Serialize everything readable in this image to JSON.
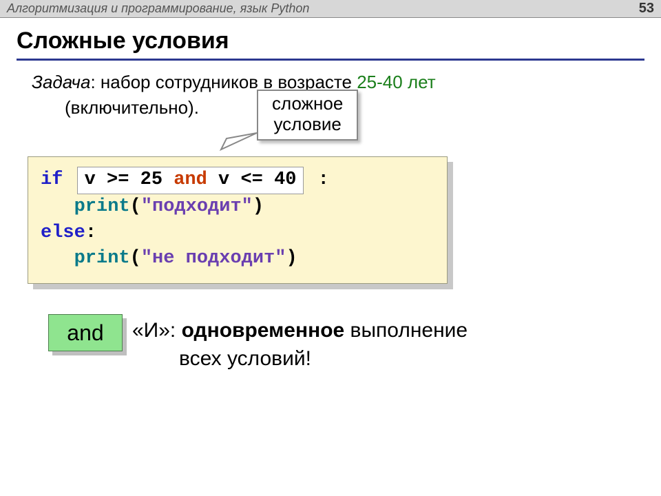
{
  "header": {
    "title": "Алгоритмизация и программирование, язык Python",
    "page": "53"
  },
  "slide": {
    "title": "Сложные условия",
    "task_label": "Задача",
    "task_text": ": набор сотрудников в возрасте ",
    "age_range": "25-40 лет",
    "inclusive": "(включительно).",
    "callout_l1": "сложное",
    "callout_l2": "условие"
  },
  "code": {
    "if_kw": "if",
    "cond_v1": "v >= ",
    "cond_n1": "25",
    "cond_and": " and ",
    "cond_v2": "v <= ",
    "cond_n2": "40",
    "colon": ":",
    "print_fn": "print",
    "str_ok": "\"подходит\"",
    "else_kw": "else",
    "str_no": "\"не подходит\""
  },
  "and_box": {
    "chip": "and",
    "desc_prefix": "«И»: ",
    "desc_bold": "одновременное",
    "desc_rest1": " выполнение",
    "desc_rest2": "всех условий!"
  }
}
